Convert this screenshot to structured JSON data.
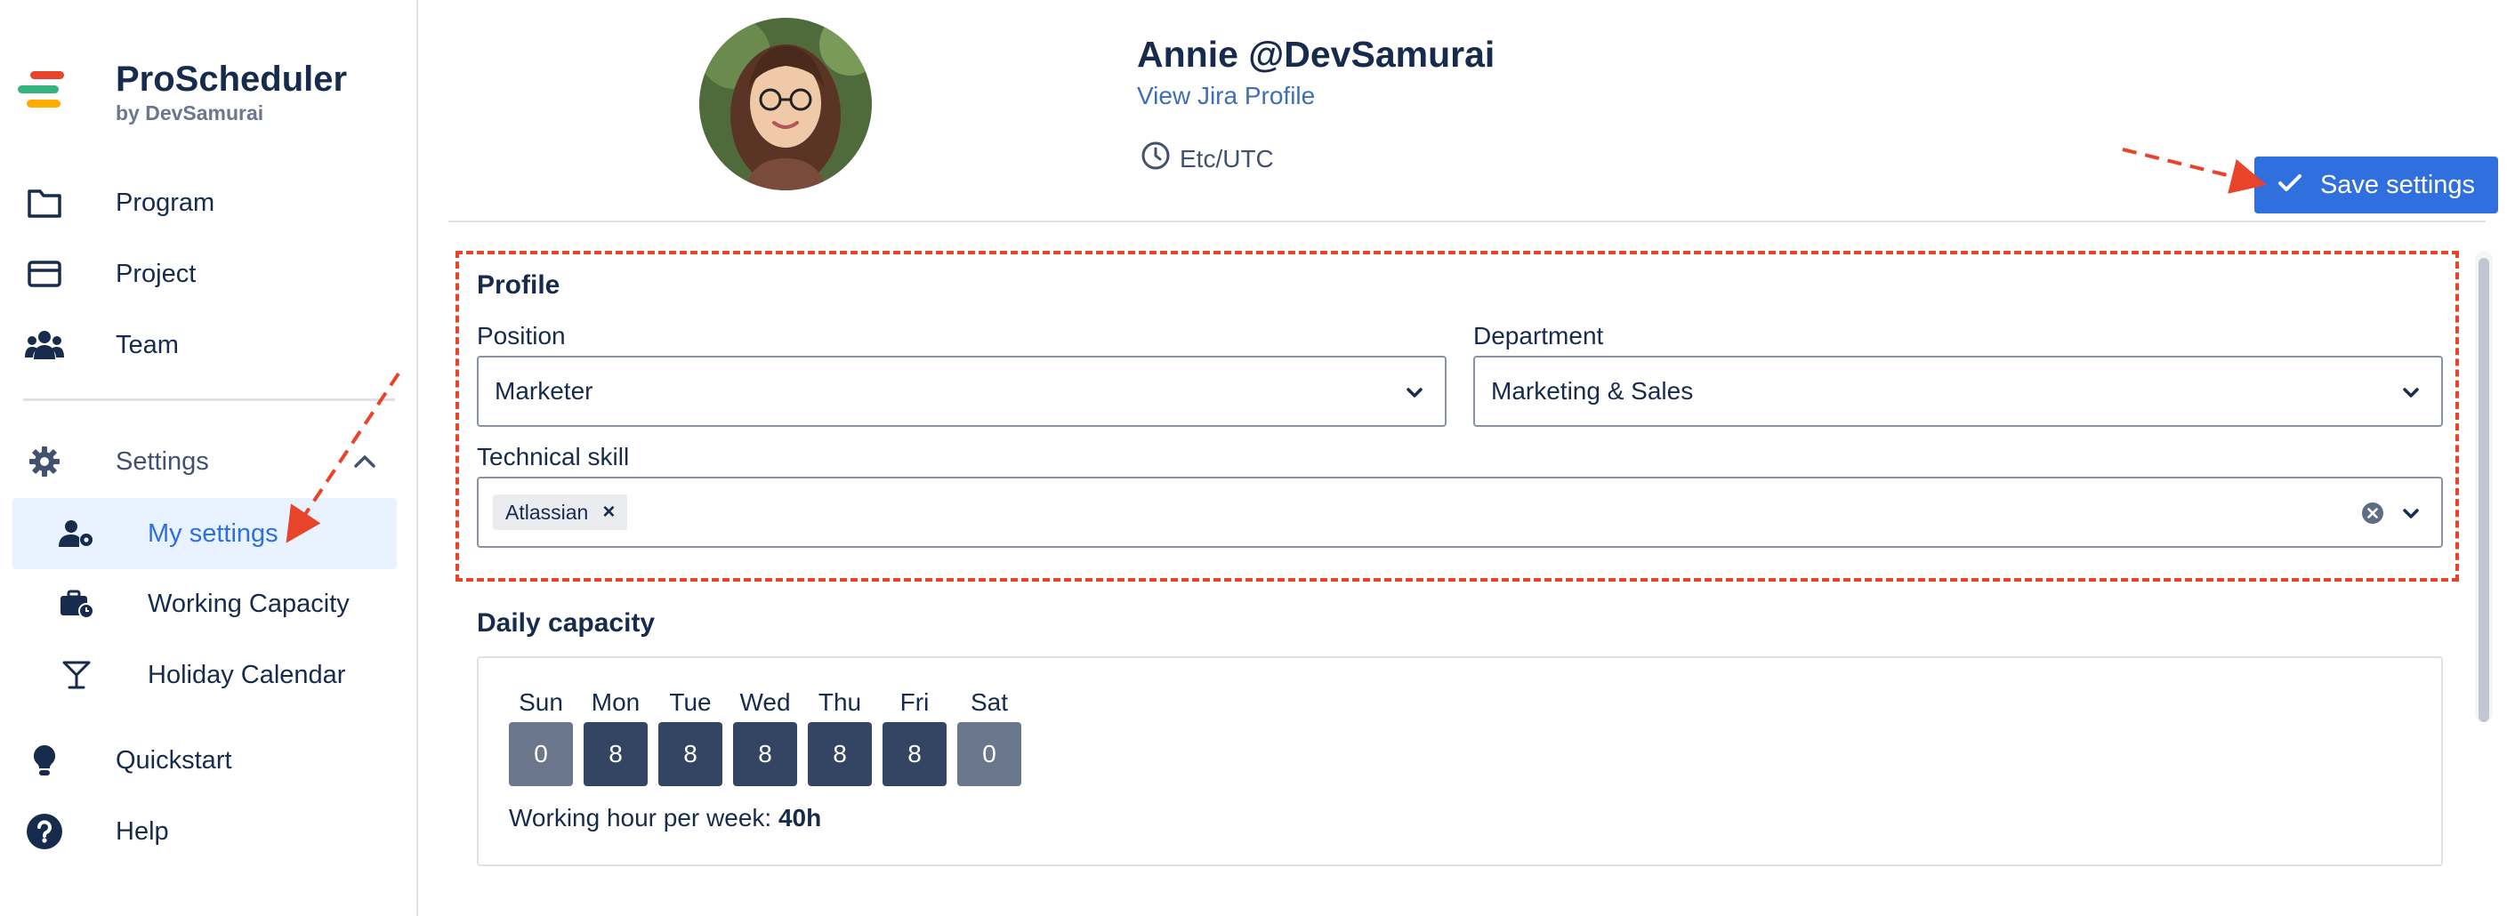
{
  "brand": {
    "name": "ProScheduler",
    "by": "by DevSamurai",
    "colors": [
      "#e8432b",
      "#36b37e",
      "#ffab00"
    ]
  },
  "sidebar": {
    "items": [
      {
        "label": "Program",
        "icon": "folder-icon"
      },
      {
        "label": "Project",
        "icon": "card-icon"
      },
      {
        "label": "Team",
        "icon": "users-icon"
      }
    ],
    "settings": {
      "label": "Settings",
      "icon": "gear-icon",
      "children": [
        {
          "label": "My settings",
          "icon": "user-gear-icon",
          "active": true
        },
        {
          "label": "Working Capacity",
          "icon": "briefcase-clock-icon"
        },
        {
          "label": "Holiday Calendar",
          "icon": "cocktail-icon"
        }
      ]
    },
    "bottom": [
      {
        "label": "Quickstart",
        "icon": "lightbulb-icon"
      },
      {
        "label": "Help",
        "icon": "help-icon"
      }
    ]
  },
  "header": {
    "user_name": "Annie @DevSamurai",
    "profile_link": "View Jira Profile",
    "timezone": "Etc/UTC",
    "save_label": "Save settings"
  },
  "profile": {
    "title": "Profile",
    "position_label": "Position",
    "position_value": "Marketer",
    "department_label": "Department",
    "department_value": "Marketing & Sales",
    "skill_label": "Technical skill",
    "skills": [
      "Atlassian"
    ]
  },
  "capacity": {
    "title": "Daily capacity",
    "days": [
      {
        "name": "Sun",
        "hours": "0"
      },
      {
        "name": "Mon",
        "hours": "8"
      },
      {
        "name": "Tue",
        "hours": "8"
      },
      {
        "name": "Wed",
        "hours": "8"
      },
      {
        "name": "Thu",
        "hours": "8"
      },
      {
        "name": "Fri",
        "hours": "8"
      },
      {
        "name": "Sat",
        "hours": "0"
      }
    ],
    "week_label": "Working hour per week:",
    "week_value": "40h"
  },
  "colors": {
    "accent": "#2f6fde",
    "annotation": "#e8432b",
    "workday": "#344563",
    "weekend": "#6b778c"
  }
}
